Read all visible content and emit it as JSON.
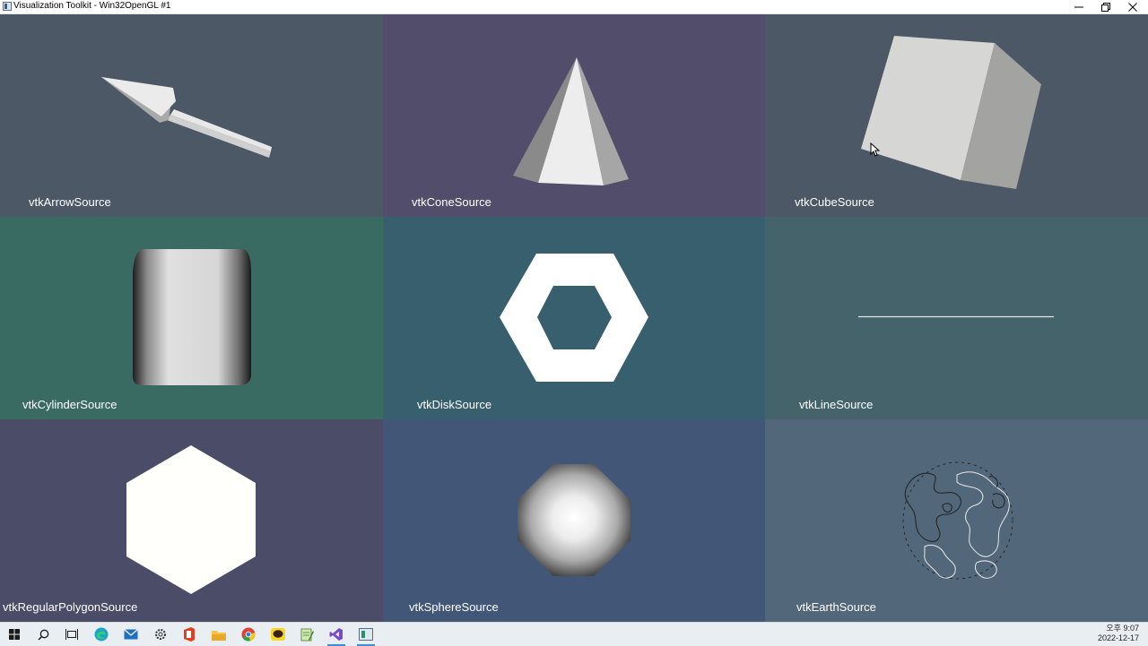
{
  "window": {
    "title": "Visualization Toolkit - Win32OpenGL #1",
    "controls": [
      "minimize-icon",
      "restore-icon",
      "close-icon"
    ]
  },
  "viewports": [
    {
      "label": "vtkArrowSource",
      "background": "#4c5866",
      "shape": "arrow"
    },
    {
      "label": "vtkConeSource",
      "background": "#524d6b",
      "shape": "cone"
    },
    {
      "label": "vtkCubeSource",
      "background": "#4c5866",
      "shape": "cube"
    },
    {
      "label": "vtkCylinderSource",
      "background": "#3a6b62",
      "shape": "cylinder"
    },
    {
      "label": "vtkDiskSource",
      "background": "#375f6e",
      "shape": "disk"
    },
    {
      "label": "vtkLineSource",
      "background": "#44636b",
      "shape": "line"
    },
    {
      "label": "vtkRegularPolygonSource",
      "background": "#4b4d68",
      "shape": "regular-polygon"
    },
    {
      "label": "vtkSphereSource",
      "background": "#425778",
      "shape": "sphere"
    },
    {
      "label": "vtkEarthSource",
      "background": "#52677a",
      "shape": "earth"
    }
  ],
  "taskbar": {
    "items": [
      "windows-start-icon",
      "search-icon",
      "task-view-icon",
      "edge-icon",
      "mail-icon",
      "settings-icon",
      "office-icon",
      "file-explorer-icon",
      "chrome-icon",
      "kakaotalk-icon",
      "notepad-icon",
      "visual-studio-icon",
      "vtk-window-icon"
    ],
    "clock_time": "오후 9:07",
    "clock_date": "2022-12-17"
  }
}
